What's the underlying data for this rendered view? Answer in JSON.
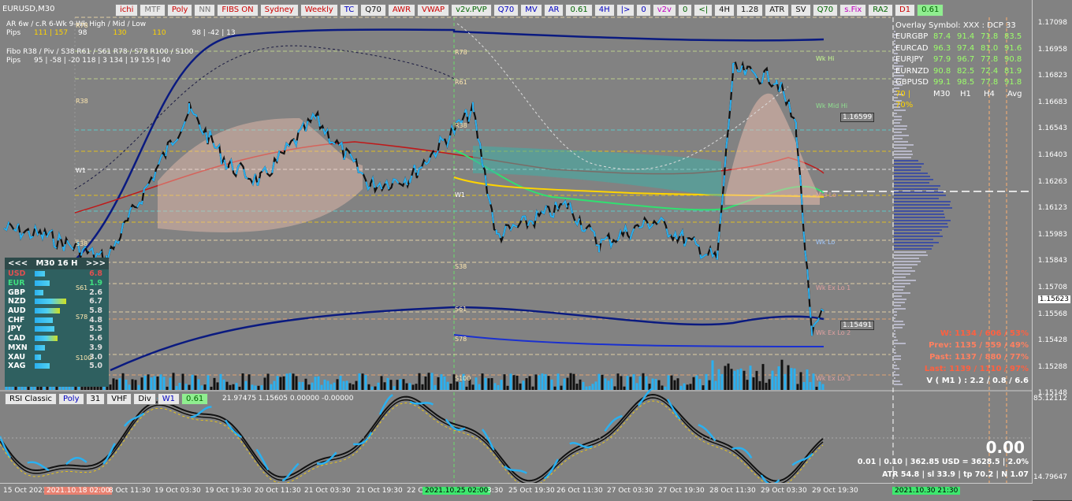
{
  "symbol": "EURUSD,M30",
  "toolbar": [
    "ichi",
    "MTF",
    "Poly",
    "NN",
    "FIBS ON",
    "Sydney",
    "Weekly",
    "TC",
    "Q70",
    "AWR",
    "VWAP",
    "v2v.PVP",
    "Q70",
    "MV",
    "AR",
    "0.61",
    "4H",
    "|>",
    "0",
    "v2v",
    "0",
    "<|",
    "4H",
    "1.28",
    "ATR",
    "SV",
    "Q70",
    "s.Fix",
    "RA2",
    "D1",
    "0.61"
  ],
  "info": {
    "ar_row1": "AR     6w / c.R      6-Wk      9-Wk        High / Mid / Low",
    "pips1_label": "Pips",
    "pips1": [
      "111 | 157",
      "98",
      "130",
      "110",
      "98  |  -42  |  13"
    ],
    "fibo_row": "Fibo   R38 / Piv / S38     R61 / S61     R78 / S78     R100 / S100",
    "pips2": "95  |  -58  |  -20     118  |  3       134  |  19      155  |  40"
  },
  "overlay": {
    "title": "Overlay Symbol: XXX : DCP 33",
    "rows": [
      {
        "sym": "EURGBP",
        "v": [
          "87.4",
          "91.4",
          "71.8",
          "83.5"
        ]
      },
      {
        "sym": "EURCAD",
        "v": [
          "96.3",
          "97.4",
          "81.0",
          "91.6"
        ]
      },
      {
        "sym": "EURJPY",
        "v": [
          "97.9",
          "96.7",
          "77.8",
          "90.8"
        ]
      },
      {
        "sym": "EURNZD",
        "v": [
          "90.8",
          "82.5",
          "72.4",
          "81.9"
        ]
      },
      {
        "sym": "GBPUSD",
        "v": [
          "99.1",
          "98.5",
          "77.8",
          "91.8"
        ]
      }
    ],
    "footer": {
      "pct": "70 | 70%",
      "tfs": [
        "M30",
        "H1",
        "H4",
        "Avg"
      ]
    }
  },
  "price_ticks": [
    "1.17098",
    "1.16958",
    "1.16823",
    "1.16683",
    "1.16543",
    "1.16403",
    "1.16263",
    "1.16123",
    "1.15983",
    "1.15843",
    "1.15708",
    "1.15568",
    "1.15428",
    "1.15288",
    "1.15148"
  ],
  "price_labels": {
    "current": "1.15623",
    "marker1": "1.16599",
    "marker2": "1.15491"
  },
  "sub_ticks": {
    "top": "85.12112",
    "bottom": "14.79647"
  },
  "time_ticks": [
    "15 Oct 2021",
    "2021.10.18 02:00",
    "8 Oct 11:30",
    "19 Oct 03:30",
    "19 Oct 19:30",
    "20 Oct 11:30",
    "21 Oct 03:30",
    "21 Oct 19:30",
    "22 C",
    "2021.10.25 02:00",
    "3:30",
    "25 Oct 19:30",
    "26 Oct 11:30",
    "27 Oct 03:30",
    "27 Oct 19:30",
    "28 Oct 11:30",
    "29 Oct 03:30",
    "29 Oct 19:30",
    "2021.10.30 21:30"
  ],
  "levels": {
    "left": [
      "R78",
      "R38",
      "W1",
      "S38"
    ],
    "mid": [
      "R78",
      "R61",
      "R38",
      "W1",
      "S38",
      "S61",
      "S78",
      "S100"
    ],
    "right": [
      "Wk Hi",
      "Wk Mid Hi",
      "Mid Lo",
      "Wk Lo",
      "Wk Ex Lo 1",
      "Wk Ex Lo 2",
      "Wk Ex Lo 3"
    ],
    "strength_inner": [
      "S61",
      "S78",
      "S100"
    ]
  },
  "strength": {
    "header": {
      "prev": "<<<",
      "tf": "M30  16  H",
      "next": ">>>"
    },
    "rows": [
      {
        "cur": "USD",
        "val": "6.8",
        "color": "#e05050"
      },
      {
        "cur": "EUR",
        "val": "1.9",
        "color": "#40e080"
      },
      {
        "cur": "GBP",
        "val": "2.6",
        "color": "#ffffff"
      },
      {
        "cur": "NZD",
        "val": "6.7",
        "color": "#ffffff"
      },
      {
        "cur": "AUD",
        "val": "5.8",
        "color": "#ffffff"
      },
      {
        "cur": "CHF",
        "val": "4.8",
        "color": "#ffffff"
      },
      {
        "cur": "JPY",
        "val": "5.5",
        "color": "#ffffff"
      },
      {
        "cur": "CAD",
        "val": "5.6",
        "color": "#ffffff"
      },
      {
        "cur": "MXN",
        "val": "3.9",
        "color": "#ffffff"
      },
      {
        "cur": "XAU",
        "val": "3.0",
        "color": "#ffffff"
      },
      {
        "cur": "XAG",
        "val": "5.0",
        "color": "#ffffff"
      }
    ],
    "bar_fractions": [
      0.3,
      0.45,
      0.25,
      0.95,
      0.75,
      0.55,
      0.6,
      0.7,
      0.3,
      0.2,
      0.45
    ]
  },
  "stats": {
    "w": "W: 1134 / 606 / 53%",
    "prev": "Prev: 1135 / 559 / 49%",
    "past": "Past: 1137 / 880 / 77%",
    "last": "Last: 1139 / 1110 / 97%",
    "v": "V ( M1 ) : 2.2 / 0.8 / 6.6"
  },
  "sub": {
    "buttons": [
      "RSI Classic",
      "Poly",
      "31",
      "VHF",
      "Div",
      "W1",
      "0.61"
    ],
    "values": "21.97475  1.15605  0.00000  -0.00000"
  },
  "bottom": {
    "big": "0.00",
    "line1": "0.01   |   0.10   |   362.85 USD = 3628.5   |   2.0%",
    "line2": "ATR 54.8  |  sl 33.9  |  tp 70.2  |  N 1.07"
  },
  "colors": {
    "bg": "#828282",
    "price": "#2ab0f0",
    "ma_blue": "#0a1a80",
    "red": "#d02020",
    "green": "#30e070",
    "yellow": "#ffd400"
  }
}
